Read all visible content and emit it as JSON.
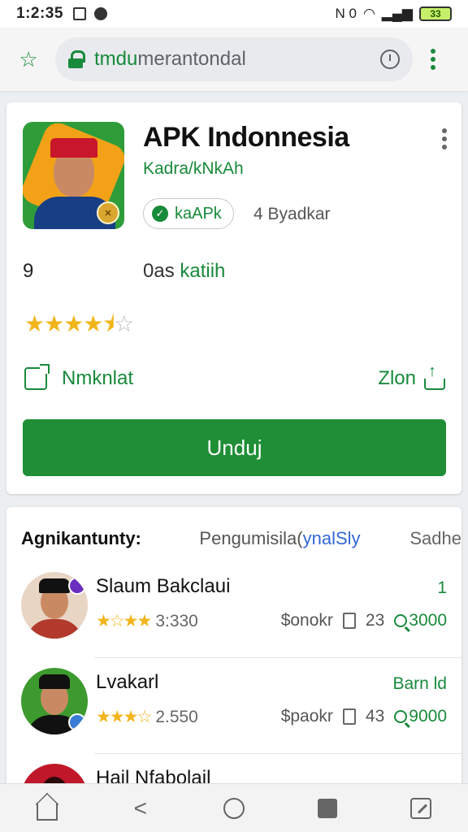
{
  "status_bar": {
    "time": "1:2:35",
    "right_text": "N 0",
    "battery": "33"
  },
  "browser": {
    "url_host": "tmdu",
    "url_path": "merantondal"
  },
  "app": {
    "title": "APK Indonnesia",
    "developer": "Kadra/kNkAh",
    "verify_label": "kaAPk",
    "installs": "4 Byadkar",
    "stat_left": "9",
    "stat_mid_prefix": "0as",
    "stat_mid_green": "katiih",
    "rating": 4.5,
    "share_left_label": "Nmknlat",
    "share_right_label": "Zlon",
    "download_label": "Unduj"
  },
  "list": {
    "header_title": "Agnikantunty:",
    "header_mid_prefix": "Pengumisila(",
    "header_mid_blue": "ynalSly",
    "header_right": "Sadhe",
    "items": [
      {
        "name": "Slaum Bakclaui",
        "stars": "★☆★★",
        "rating_text": "3:330",
        "right_top": "1",
        "meta_price": "$onokr",
        "meta_count": "23",
        "meta_value": "3000"
      },
      {
        "name": "Lvakarl",
        "stars": "★★★☆",
        "rating_text": "2.550",
        "right_top": "Barn ld",
        "meta_price": "$paokr",
        "meta_count": "43",
        "meta_value": "9000"
      },
      {
        "name": "Hail Nfabolail",
        "stars": "",
        "rating_text": "",
        "right_top": "",
        "meta_price": "",
        "meta_count": "",
        "meta_value": ""
      }
    ]
  },
  "colors": {
    "accent_green": "#1f8e36",
    "star": "#f1b51c",
    "link_blue": "#3367d6"
  },
  "icons": {
    "nav": [
      "home-icon",
      "back-icon",
      "circle-home-icon",
      "square-recents-icon",
      "edit-icon"
    ]
  }
}
